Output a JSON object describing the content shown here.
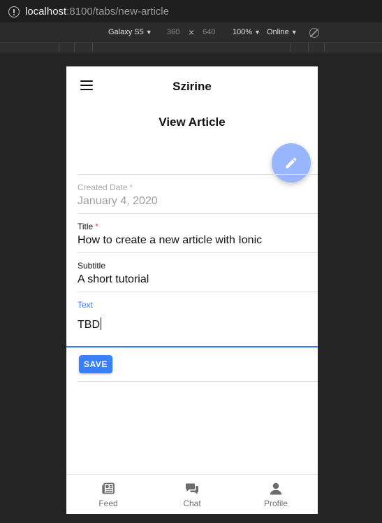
{
  "browser": {
    "url_host": "localhost",
    "url_path": ":8100/tabs/new-article"
  },
  "device_toolbar": {
    "device": "Galaxy S5",
    "width": "360",
    "times": "×",
    "height": "640",
    "zoom": "100%",
    "network": "Online"
  },
  "header": {
    "title": "Szirine"
  },
  "page": {
    "title": "View Article"
  },
  "form": {
    "created_date": {
      "label": "Created Date",
      "required_mark": "*",
      "value": "January 4, 2020"
    },
    "title": {
      "label": "Title",
      "required_mark": "*",
      "value": "How to create a new article with Ionic"
    },
    "subtitle": {
      "label": "Subtitle",
      "value": "A short tutorial"
    },
    "text": {
      "label": "Text",
      "value": "TBD"
    },
    "save_label": "SAVE"
  },
  "tabs": [
    {
      "label": "Feed",
      "icon": "newspaper-icon"
    },
    {
      "label": "Chat",
      "icon": "chat-icon"
    },
    {
      "label": "Profile",
      "icon": "person-icon"
    }
  ],
  "colors": {
    "primary": "#3880ff",
    "fab": "#98b6ff",
    "danger": "#eb445a"
  }
}
